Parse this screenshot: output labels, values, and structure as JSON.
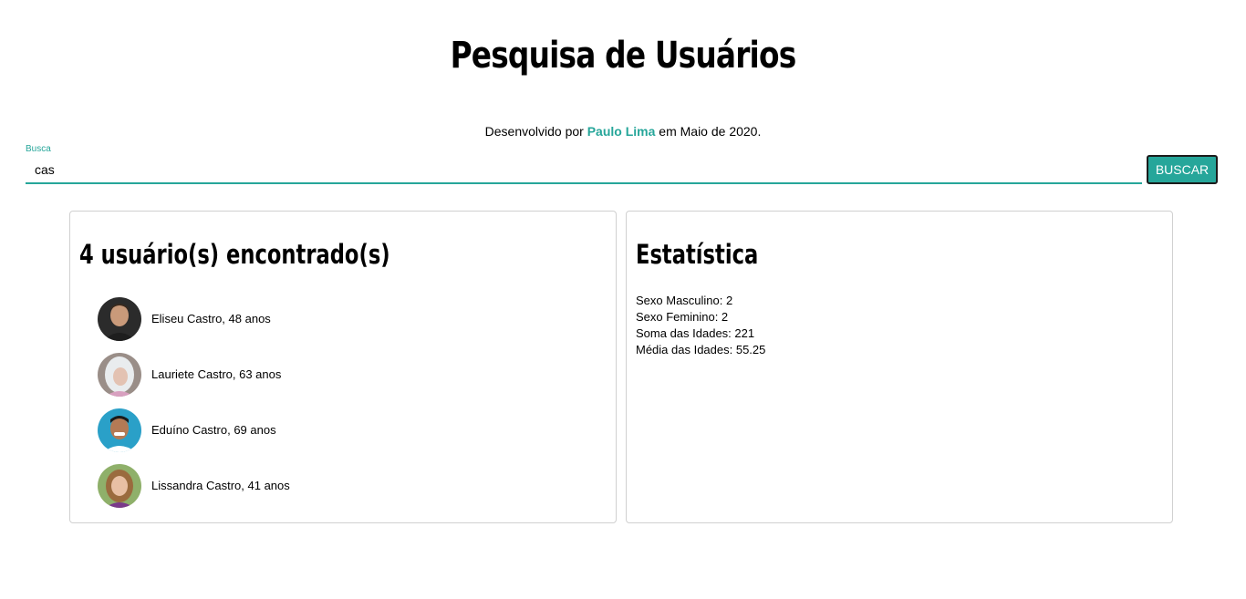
{
  "header": {
    "title": "Pesquisa de Usuários",
    "credits_prefix": "Desenvolvido por ",
    "credits_author": "Paulo Lima",
    "credits_suffix": " em Maio de 2020."
  },
  "search": {
    "label": "Busca",
    "value": "cas",
    "button_label": "BUSCAR"
  },
  "results": {
    "title": "4 usuário(s) encontrado(s)",
    "users": [
      {
        "text": "Eliseu Castro, 48 anos"
      },
      {
        "text": "Lauriete Castro, 63 anos"
      },
      {
        "text": "Eduíno Castro, 69 anos"
      },
      {
        "text": "Lissandra Castro, 41 anos"
      }
    ]
  },
  "stats": {
    "title": "Estatística",
    "male": "Sexo Masculino: 2",
    "female": "Sexo Feminino: 2",
    "age_sum": "Soma das Idades: 221",
    "age_avg": "Média das Idades: 55.25"
  },
  "colors": {
    "accent": "#26a69a"
  }
}
